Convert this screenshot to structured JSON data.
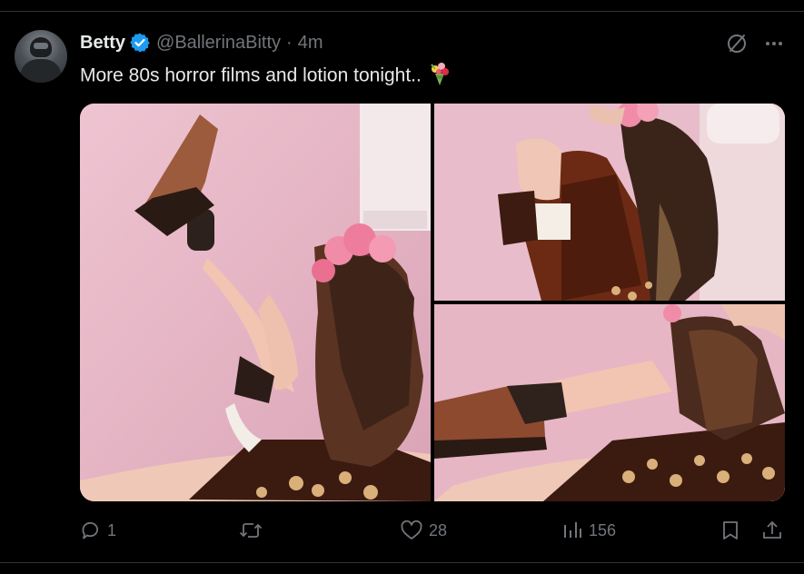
{
  "tweet": {
    "author_name": "Betty",
    "handle": "@BallerinaBitty",
    "separator": "·",
    "time": "4m",
    "text": "More 80s horror films and lotion tonight..",
    "emoji": "bouquet-emoji",
    "verified_color": "#1d9bf0"
  },
  "media": {
    "photo_count": 3,
    "background_tone": "#e5b7c5"
  },
  "actions": {
    "replies": "1",
    "reposts": "",
    "likes": "28",
    "views": "156"
  },
  "icons": {
    "reply": "reply-icon",
    "repost": "repost-icon",
    "like": "heart-icon",
    "views": "analytics-icon",
    "bookmark": "bookmark-icon",
    "share": "share-icon",
    "grok": "grok-icon",
    "more": "more-icon"
  },
  "colors": {
    "background": "#000000",
    "text": "#e7e9ea",
    "secondary": "#71767b",
    "divider": "#2f3336",
    "accent": "#1d9bf0"
  }
}
